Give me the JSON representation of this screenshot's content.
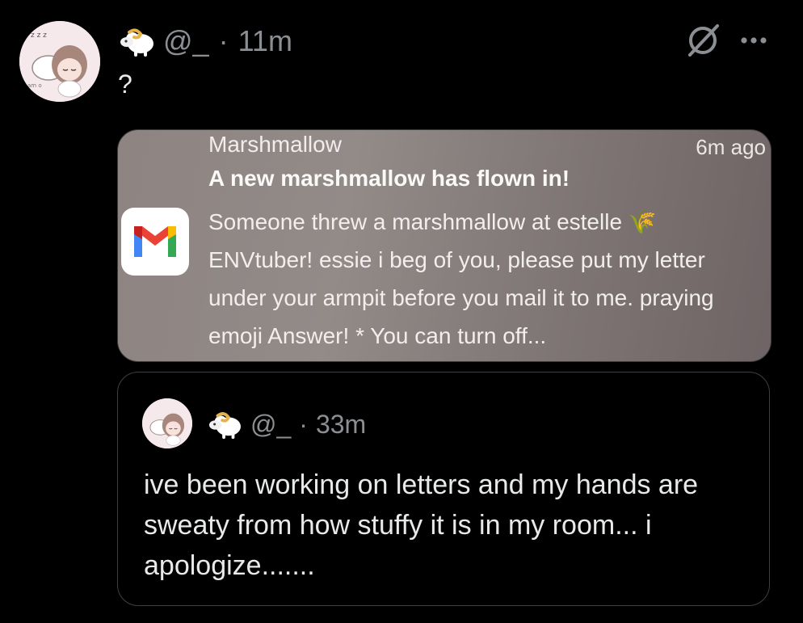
{
  "tweet": {
    "handle": "@_",
    "separator": "·",
    "time": "11m",
    "text": "?"
  },
  "notification": {
    "app_icon": "gmail-icon",
    "app_name": "Marshmallow",
    "time": "6m ago",
    "title": "A new marshmallow has flown in!",
    "body": "Someone threw a marshmallow at estelle 🌾 ENVtuber! essie i beg of you, please put my letter under your armpit before you mail it to me. praying emoji Answer! * You can turn off..."
  },
  "quoted_tweet": {
    "handle": "@_",
    "separator": "·",
    "time": "33m",
    "text": "ive been working on letters and my hands are sweaty from how stuffy it is in my room... i apologize......."
  },
  "icons": {
    "grok": "grok-icon",
    "more": "more-icon",
    "badge": "sheep-icon"
  },
  "colors": {
    "background": "#000000",
    "text": "#e7e9ea",
    "muted": "#8b8f94",
    "border": "#3b4045"
  }
}
